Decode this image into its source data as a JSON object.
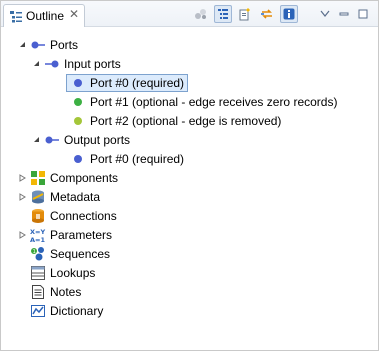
{
  "tab": {
    "label": "Outline",
    "close_glyph": "✕"
  },
  "toolbar": {
    "icons": [
      "filter-icon",
      "hierarchy-icon",
      "new-icon",
      "sync-icon",
      "info-icon",
      "view-menu-icon",
      "minimize-icon",
      "maximize-icon"
    ]
  },
  "colors": {
    "required_port": "#4a5fd0",
    "optional_zero": "#3cb043",
    "optional_removed": "#a4c639",
    "selection_bg": "#dcebfc",
    "selection_border": "#7da2ce"
  },
  "tree": {
    "ports": "Ports",
    "input_ports": "Input ports",
    "in0": "Port #0 (required)",
    "in1": "Port #1 (optional - edge receives zero records)",
    "in2": "Port #2 (optional - edge is removed)",
    "output_ports": "Output ports",
    "out0": "Port #0 (required)",
    "components": "Components",
    "metadata": "Metadata",
    "connections": "Connections",
    "parameters": "Parameters",
    "sequences": "Sequences",
    "lookups": "Lookups",
    "notes": "Notes",
    "dictionary": "Dictionary"
  }
}
